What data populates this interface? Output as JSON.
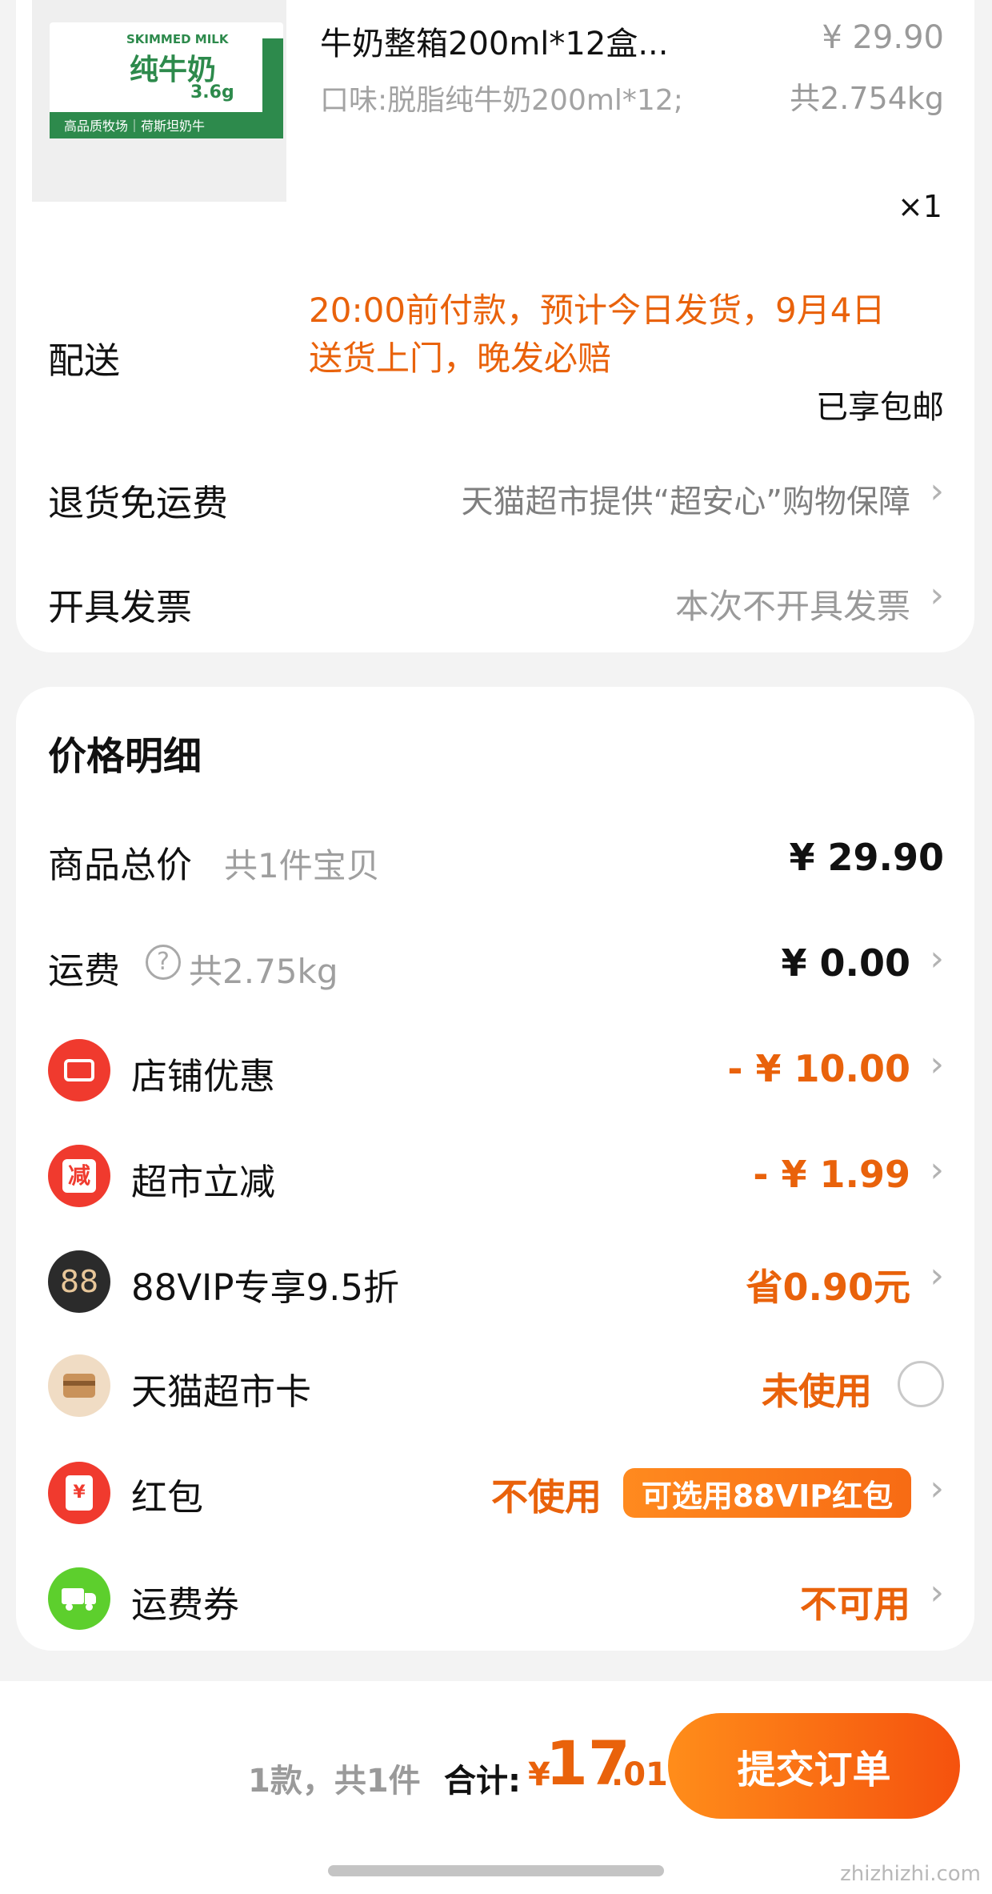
{
  "item": {
    "thumb": {
      "t1": "SKIMMED MILK",
      "t2": "纯牛奶",
      "t3": "3.6g",
      "t4": "高品质牧场｜荷斯坦奶牛"
    },
    "title": "牛奶整箱200ml*12盒...",
    "price": "¥ 29.90",
    "sku": "口味:脱脂纯牛奶200ml*12;",
    "weight": "共2.754kg",
    "qty": "×1"
  },
  "delivery": {
    "label": "配送",
    "line1": "20:00前付款，预计今日发货，9月4日",
    "line2": "送货上门，晚发必赔",
    "shipping": "已享包邮"
  },
  "return": {
    "label": "退货免运费",
    "value": "天猫超市提供“超安心”购物保障"
  },
  "invoice": {
    "label": "开具发票",
    "value": "本次不开具发票"
  },
  "price_detail": {
    "title": "价格明细",
    "goods_total": {
      "label": "商品总价",
      "sub": "共1件宝贝",
      "value": "¥ 29.90"
    },
    "shipping": {
      "label": "运费",
      "sub": "共2.75kg",
      "value": "¥ 0.00"
    },
    "store_discount": {
      "label": "店铺优惠",
      "value": "- ¥ 10.00"
    },
    "market_cut": {
      "label": "超市立减",
      "value": "- ¥ 1.99",
      "icon_text": "减"
    },
    "vip": {
      "label": "88VIP专享9.5折",
      "value": "省0.90元",
      "icon_text": "88"
    },
    "card": {
      "label": "天猫超市卡",
      "value": "未使用"
    },
    "red_packet": {
      "label": "红包",
      "value": "不使用",
      "badge": "可选用88VIP红包",
      "icon_text": "¥"
    },
    "freight_coupon": {
      "label": "运费券",
      "value": "不可用"
    }
  },
  "footer": {
    "count": "1款，共1件",
    "total_label": "合计:",
    "currency": "¥",
    "total_int": "17",
    "total_dec": ".01",
    "submit": "提交订单",
    "watermark": "zhizhizhi.com"
  },
  "colors": {
    "accent": "#e9620b",
    "red_icon": "#f03a2e",
    "green_icon": "#5dcf2d"
  }
}
